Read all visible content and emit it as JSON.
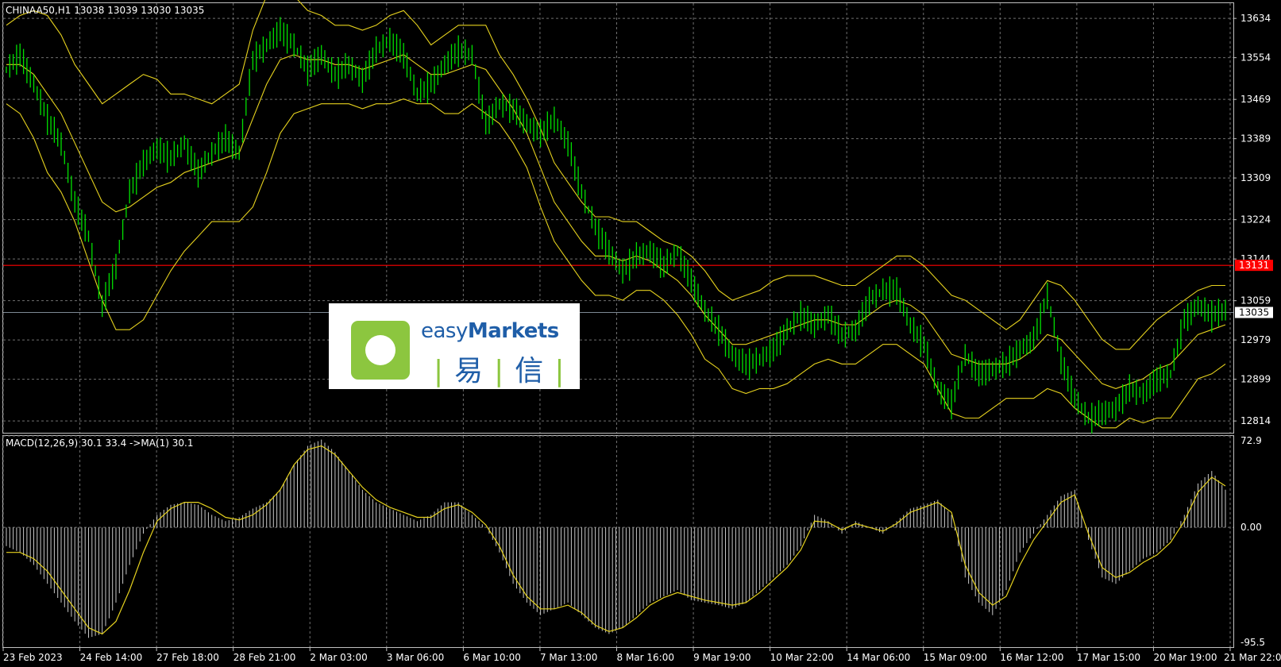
{
  "chart_data": {
    "type": "candlestick",
    "symbol_header": "CHINAA50,H1  13038 13039 13030 13035",
    "price_axis_ticks": [
      "13634",
      "13554",
      "13469",
      "13389",
      "13309",
      "13224",
      "13144",
      "13059",
      "12979",
      "12899",
      "12814"
    ],
    "price_ylim": [
      12790,
      13665
    ],
    "current_price_label": "13035",
    "current_price": 13035,
    "level_label": "13131",
    "level_price": 13131,
    "time_labels": [
      "23 Feb 2023",
      "24 Feb 14:00",
      "27 Feb 18:00",
      "28 Feb 21:00",
      "2 Mar 03:00",
      "3 Mar 06:00",
      "6 Mar 10:00",
      "7 Mar 13:00",
      "8 Mar 16:00",
      "9 Mar 19:00",
      "10 Mar 22:00",
      "14 Mar 06:00",
      "15 Mar 09:00",
      "16 Mar 12:00",
      "17 Mar 15:00",
      "20 Mar 19:00",
      "21 Mar 22:00"
    ],
    "grid": true,
    "close_path": [
      13530,
      13560,
      13500,
      13430,
      13380,
      13260,
      13190,
      13050,
      13130,
      13280,
      13340,
      13370,
      13350,
      13380,
      13320,
      13360,
      13390,
      13360,
      13550,
      13580,
      13610,
      13580,
      13530,
      13560,
      13520,
      13540,
      13510,
      13570,
      13590,
      13560,
      13480,
      13500,
      13540,
      13570,
      13560,
      13420,
      13460,
      13450,
      13420,
      13400,
      13430,
      13380,
      13280,
      13210,
      13160,
      13120,
      13150,
      13160,
      13130,
      13160,
      13100,
      13040,
      13000,
      12950,
      12930,
      12940,
      12960,
      13000,
      13030,
      13010,
      13030,
      12990,
      13000,
      13060,
      13080,
      13080,
      13010,
      12970,
      12880,
      12850,
      12950,
      12910,
      12920,
      12930,
      12960,
      12980,
      13070,
      12940,
      12860,
      12820,
      12830,
      12840,
      12880,
      12870,
      12900,
      12910,
      13020,
      13050,
      13030,
      13040
    ],
    "bollinger_upper_path": [
      13620,
      13640,
      13650,
      13640,
      13600,
      13540,
      13500,
      13460,
      13480,
      13500,
      13520,
      13510,
      13480,
      13480,
      13470,
      13460,
      13480,
      13500,
      13610,
      13680,
      13700,
      13680,
      13650,
      13640,
      13620,
      13620,
      13610,
      13620,
      13640,
      13650,
      13620,
      13580,
      13600,
      13620,
      13620,
      13620,
      13560,
      13520,
      13470,
      13410,
      13340,
      13300,
      13260,
      13230,
      13230,
      13220,
      13220,
      13200,
      13180,
      13170,
      13150,
      13120,
      13080,
      13060,
      13070,
      13080,
      13100,
      13110,
      13110,
      13110,
      13100,
      13090,
      13090,
      13110,
      13130,
      13150,
      13150,
      13130,
      13100,
      13070,
      13060,
      13040,
      13020,
      13000,
      13020,
      13060,
      13100,
      13090,
      13060,
      13020,
      12980,
      12960,
      12960,
      12990,
      13020,
      13040,
      13060,
      13080,
      13090,
      13090
    ],
    "bollinger_mid_path": [
      13540,
      13540,
      13520,
      13480,
      13440,
      13380,
      13320,
      13260,
      13240,
      13250,
      13270,
      13290,
      13300,
      13320,
      13330,
      13340,
      13350,
      13360,
      13430,
      13500,
      13550,
      13560,
      13550,
      13550,
      13540,
      13540,
      13530,
      13540,
      13550,
      13560,
      13540,
      13520,
      13520,
      13530,
      13540,
      13530,
      13490,
      13450,
      13400,
      13330,
      13260,
      13220,
      13180,
      13150,
      13150,
      13140,
      13150,
      13140,
      13120,
      13100,
      13070,
      13030,
      13000,
      12970,
      12970,
      12980,
      12990,
      13000,
      13010,
      13020,
      13020,
      13010,
      13010,
      13030,
      13050,
      13060,
      13050,
      13030,
      12990,
      12950,
      12940,
      12930,
      12930,
      12930,
      12940,
      12960,
      12990,
      12980,
      12950,
      12920,
      12890,
      12880,
      12890,
      12900,
      12920,
      12930,
      12960,
      12990,
      13000,
      13010
    ],
    "bollinger_lower_path": [
      13460,
      13440,
      13390,
      13320,
      13280,
      13220,
      13140,
      13060,
      13000,
      13000,
      13020,
      13070,
      13120,
      13160,
      13190,
      13220,
      13220,
      13220,
      13250,
      13320,
      13400,
      13440,
      13450,
      13460,
      13460,
      13460,
      13450,
      13460,
      13460,
      13470,
      13460,
      13460,
      13440,
      13440,
      13460,
      13440,
      13420,
      13380,
      13330,
      13250,
      13180,
      13140,
      13100,
      13070,
      13070,
      13060,
      13080,
      13080,
      13060,
      13030,
      12990,
      12940,
      12920,
      12880,
      12870,
      12880,
      12880,
      12890,
      12910,
      12930,
      12940,
      12930,
      12930,
      12950,
      12970,
      12970,
      12950,
      12930,
      12880,
      12830,
      12820,
      12820,
      12840,
      12860,
      12860,
      12860,
      12880,
      12870,
      12840,
      12820,
      12800,
      12800,
      12820,
      12810,
      12820,
      12820,
      12860,
      12900,
      12910,
      12930
    ],
    "macd_header": "MACD(12,26,9) 30.1 33.4  ->MA(1) 30.1",
    "macd_ticks": [
      "72.9",
      "0.00",
      "-95.5"
    ],
    "macd_ylim": [
      -95.5,
      72.9
    ],
    "macd_hist_path": [
      -15,
      -20,
      -30,
      -45,
      -60,
      -75,
      -88,
      -85,
      -60,
      -30,
      -5,
      10,
      18,
      20,
      18,
      10,
      5,
      8,
      15,
      20,
      30,
      50,
      65,
      70,
      60,
      45,
      30,
      20,
      15,
      10,
      5,
      10,
      20,
      20,
      10,
      0,
      -20,
      -45,
      -60,
      -70,
      -65,
      -60,
      -70,
      -80,
      -85,
      -80,
      -70,
      -60,
      -55,
      -50,
      -58,
      -60,
      -62,
      -65,
      -60,
      -50,
      -40,
      -30,
      -15,
      10,
      5,
      -5,
      5,
      0,
      -5,
      5,
      15,
      18,
      22,
      10,
      -40,
      -60,
      -70,
      -50,
      -20,
      -5,
      10,
      25,
      30,
      -10,
      -40,
      -45,
      -35,
      -25,
      -20,
      -10,
      10,
      35,
      45,
      30
    ],
    "macd_signal_path": [
      -20,
      -20,
      -25,
      -35,
      -50,
      -65,
      -80,
      -85,
      -75,
      -50,
      -20,
      5,
      15,
      20,
      20,
      15,
      8,
      6,
      10,
      18,
      30,
      50,
      62,
      65,
      58,
      45,
      32,
      22,
      16,
      12,
      8,
      8,
      15,
      18,
      12,
      2,
      -15,
      -38,
      -55,
      -65,
      -65,
      -62,
      -68,
      -78,
      -83,
      -80,
      -72,
      -62,
      -56,
      -52,
      -55,
      -58,
      -60,
      -62,
      -60,
      -52,
      -42,
      -32,
      -18,
      5,
      4,
      -2,
      3,
      0,
      -3,
      3,
      12,
      16,
      20,
      12,
      -30,
      -52,
      -62,
      -55,
      -30,
      -10,
      5,
      20,
      26,
      -5,
      -32,
      -40,
      -36,
      -28,
      -22,
      -12,
      5,
      28,
      40,
      33
    ]
  }
}
